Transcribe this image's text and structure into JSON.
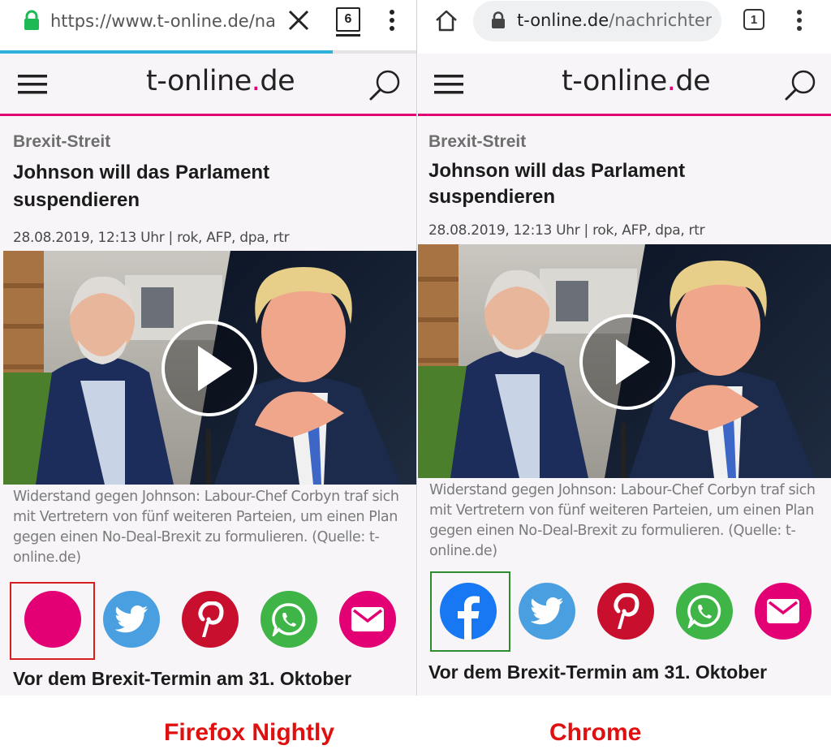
{
  "firefox": {
    "url_display": "https://www.t-online.de/nac",
    "tab_count": "6",
    "load_progress": 0.8,
    "header": {
      "logo_main": "t-online",
      "logo_dot": ".",
      "logo_tld": "de"
    },
    "article": {
      "kicker": "Brexit-Streit",
      "headline": "Johnson will das Parlament suspendieren",
      "dateline": "28.08.2019, 12:13 Uhr | rok, AFP, dpa, rtr",
      "caption": "Widerstand gegen Johnson: Labour-Chef Corbyn traf sich mit Vertretern von fünf weiteren Parteien, um einen Plan gegen einen No-Deal-Brexit zu formulieren. (Quelle: t-online.de)",
      "teaser": "Vor dem Brexit-Termin am 31. Oktober"
    },
    "label": "Firefox Nightly"
  },
  "chrome": {
    "url_host": "t-online.de",
    "url_path": "/nachrichten/",
    "tab_count": "1",
    "header": {
      "logo_main": "t-online",
      "logo_dot": ".",
      "logo_tld": "de"
    },
    "article": {
      "kicker": "Brexit-Streit",
      "headline": "Johnson will das Parlament suspendieren",
      "dateline": "28.08.2019, 12:13 Uhr | rok, AFP, dpa, rtr",
      "caption": "Widerstand gegen Johnson: Labour-Chef Corbyn traf sich mit Vertretern von fünf weiteren Parteien, um einen Plan gegen einen No-Deal-Brexit zu formulieren. (Quelle: t-online.de)",
      "teaser": "Vor dem Brexit-Termin am 31. Oktober"
    },
    "label": "Chrome"
  },
  "colors": {
    "magenta": "#e20074",
    "facebook": "#1877f2",
    "twitter": "#4a9fe0",
    "pinterest": "#c8102e",
    "whatsapp": "#3fb548",
    "email": "#e20074",
    "firefox_highlight": "#d62020",
    "chrome_highlight": "#2e8b2e",
    "label_red": "#e01010"
  },
  "share_icons": [
    "facebook-icon",
    "twitter-icon",
    "pinterest-icon",
    "whatsapp-icon",
    "email-icon"
  ]
}
